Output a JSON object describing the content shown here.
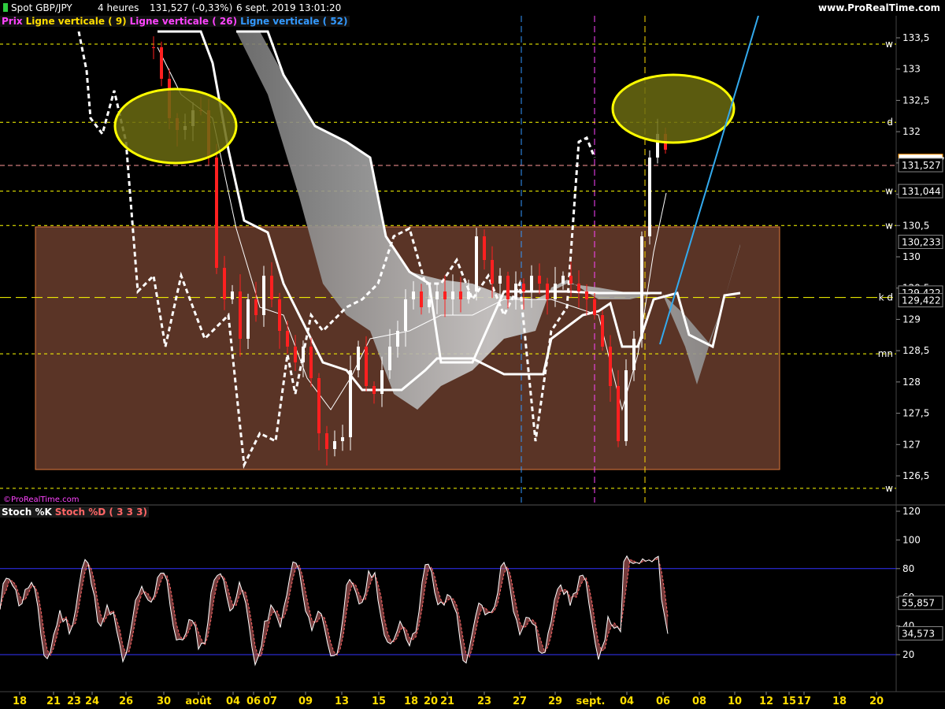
{
  "header": {
    "instrument": "Spot GBP/JPY",
    "timeframe": "4 heures",
    "last": "131,527 (-0,33%)",
    "datetime": "6 sept. 2019 13:01:20",
    "brand": "www.ProRealTime.com"
  },
  "legend": {
    "price": "Prix",
    "line1": "Ligne verticale ( 9)",
    "line2": "Ligne verticale ( 26)",
    "line3": "Ligne verticale ( 52)"
  },
  "watermark": "©ProRealTime.com",
  "stoch_legend": {
    "k": "Stoch %K",
    "d": "Stoch %D ( 3 3 3)"
  },
  "colors": {
    "up": "#ffffff",
    "down": "#ff2020",
    "legend_price": "#ff44ff",
    "legend_line1": "#ffdd00",
    "legend_line2": "#ff44ff",
    "legend_line3": "#3399ff",
    "zone_fill": "#5a3426",
    "zone_border": "#e07a3c",
    "ellipse_fill": "#6b6b12",
    "ellipse_stroke": "#ffff00",
    "trendline": "#33aaee",
    "level_line": "#ffff00",
    "price_line": "#ff9999"
  },
  "price_axis": {
    "ticks": [
      "133,5",
      "133",
      "132,5",
      "132",
      "131,5",
      "131",
      "130,5",
      "130",
      "129,5",
      "129",
      "128,5",
      "128",
      "127,5",
      "127",
      "126,5"
    ],
    "level_markers": [
      {
        "label": "w",
        "value": 133.4
      },
      {
        "label": "d",
        "value": 132.15
      },
      {
        "label": "w",
        "value": 131.05
      },
      {
        "label": "w",
        "value": 130.5
      },
      {
        "label": "k d",
        "value": 129.35
      },
      {
        "label": "mn",
        "value": 128.45
      },
      {
        "label": "w",
        "value": 126.3
      }
    ],
    "value_boxes": [
      {
        "text": "131,527",
        "value": 131.527,
        "style": "highlight"
      },
      {
        "text": "131,527",
        "value": 131.46,
        "style": "plain"
      },
      {
        "text": "131,044",
        "value": 131.044,
        "style": "plain"
      },
      {
        "text": "130,233",
        "value": 130.233,
        "style": "plain"
      },
      {
        "text": "129,422",
        "value": 129.422,
        "style": "plain"
      },
      {
        "text": "129,422",
        "value": 129.3,
        "style": "plain"
      }
    ]
  },
  "stoch_axis": {
    "ticks": [
      "120",
      "100",
      "80",
      "60",
      "40",
      "20"
    ],
    "value_boxes": [
      {
        "text": "55,857",
        "value": 55.857,
        "color": "#ff6666"
      },
      {
        "text": "34,573",
        "value": 34.573,
        "color": "#ffffff"
      }
    ]
  },
  "date_axis": {
    "labels": [
      "18",
      "21",
      "23",
      "24",
      "26",
      "30",
      "août",
      "04",
      "06",
      "07",
      "09",
      "13",
      "15",
      "18",
      "20",
      "21",
      "23",
      "27",
      "29",
      "sept.",
      "04",
      "06",
      "08",
      "10",
      "12",
      "15",
      "17",
      "18",
      "20",
      "24"
    ]
  },
  "chart_data": {
    "type": "candlestick",
    "ylim": [
      126.2,
      133.8
    ],
    "support_zone": {
      "from": 126.7,
      "to": 130.5
    },
    "ellipses": [
      {
        "center_y": 131.8
      },
      {
        "center_y": 132.3
      }
    ],
    "highlight_circles_note": "",
    "series": [
      {
        "name": "Prix"
      },
      {
        "name": "Ligne verticale ( 9)"
      },
      {
        "name": "Ligne verticale ( 26)"
      },
      {
        "name": "Ligne verticale ( 52)"
      }
    ],
    "stochastic": {
      "k_last": 34.573,
      "d_last": 55.857,
      "levels": [
        80,
        20
      ]
    }
  }
}
